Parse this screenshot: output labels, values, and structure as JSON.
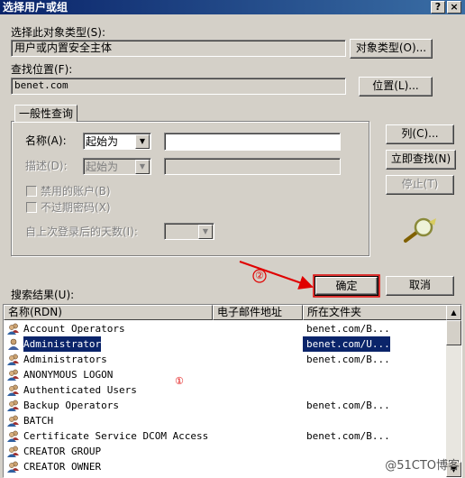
{
  "window": {
    "title": "选择用户或组",
    "help": "?",
    "close": "×"
  },
  "object_type": {
    "label": "选择此对象类型(S):",
    "value": "用户或内置安全主体",
    "button": "对象类型(O)..."
  },
  "location": {
    "label": "查找位置(F):",
    "value": "benet.com",
    "button": "位置(L)..."
  },
  "general_query": {
    "tab": "一般性查询",
    "name_label": "名称(A):",
    "name_mode": "起始为",
    "name_value": "",
    "desc_label": "描述(D):",
    "desc_mode": "起始为",
    "disabled_accounts": "禁用的账户(B)",
    "non_expiring": "不过期密码(X)",
    "days_label": "自上次登录后的天数(I):"
  },
  "side_buttons": {
    "columns": "列(C)...",
    "find_now": "立即查找(N)",
    "stop": "停止(T)"
  },
  "actions": {
    "ok": "确定",
    "cancel": "取消"
  },
  "annotations": {
    "one": "①",
    "two": "②"
  },
  "results": {
    "label": "搜索结果(U):",
    "columns": [
      "名称(RDN)",
      "电子邮件地址",
      "所在文件夹"
    ],
    "rows": [
      {
        "name": "Account Operators",
        "folder": "benet.com/B...",
        "icon": "group-icon"
      },
      {
        "name": "Administrator",
        "folder": "benet.com/U...",
        "icon": "user-icon",
        "selected": true
      },
      {
        "name": "Administrators",
        "folder": "benet.com/B...",
        "icon": "group-icon"
      },
      {
        "name": "ANONYMOUS LOGON",
        "folder": "",
        "icon": "group-icon"
      },
      {
        "name": "Authenticated Users",
        "folder": "",
        "icon": "group-icon"
      },
      {
        "name": "Backup Operators",
        "folder": "benet.com/B...",
        "icon": "group-icon"
      },
      {
        "name": "BATCH",
        "folder": "",
        "icon": "group-icon"
      },
      {
        "name": "Certificate Service DCOM Access",
        "folder": "benet.com/B...",
        "icon": "group-icon"
      },
      {
        "name": "CREATOR GROUP",
        "folder": "",
        "icon": "group-icon"
      },
      {
        "name": "CREATOR OWNER",
        "folder": "",
        "icon": "group-icon"
      }
    ]
  },
  "watermark": "@51CTO博客",
  "colors": {
    "title_bar": "#0a246a",
    "selection": "#0a246a",
    "annotation_red": "#e00000"
  }
}
